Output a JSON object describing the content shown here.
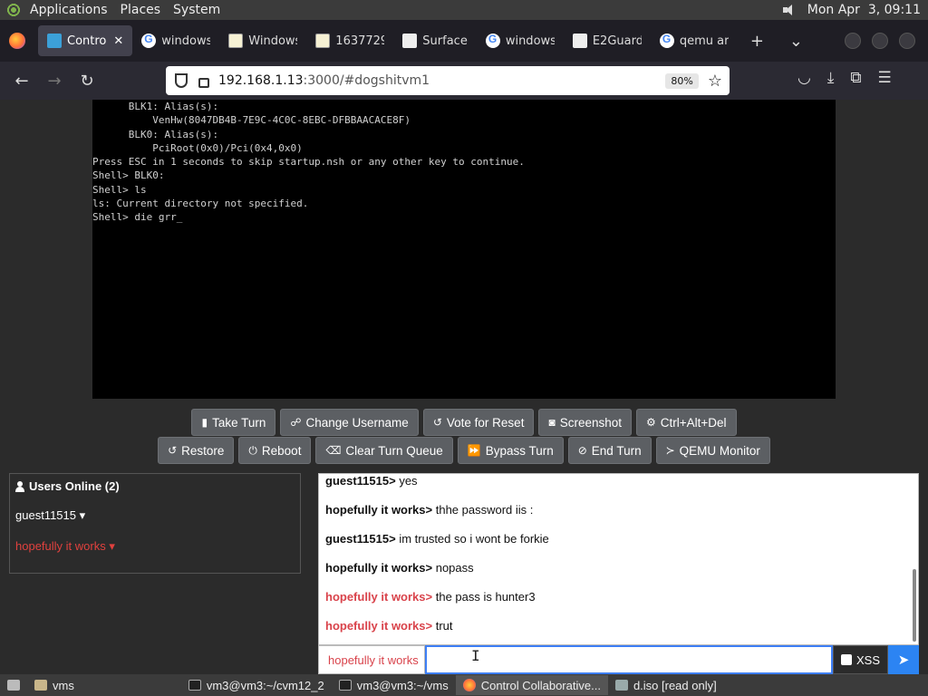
{
  "top_panel": {
    "menus": [
      "Applications",
      "Places",
      "System"
    ],
    "clock": "Mon Apr  3, 09:11"
  },
  "tabs": [
    {
      "label": "Contro",
      "icon": "monitor-icon",
      "active": true
    },
    {
      "label": "windows",
      "icon": "google-icon"
    },
    {
      "label": "Windows",
      "icon": "ba-icon"
    },
    {
      "label": "1637729",
      "icon": "ba-icon"
    },
    {
      "label": "Surface",
      "icon": "bank-icon"
    },
    {
      "label": "windows",
      "icon": "google-icon"
    },
    {
      "label": "E2Guard",
      "icon": "bank-icon"
    },
    {
      "label": "qemu ar",
      "icon": "google-icon"
    }
  ],
  "address_bar": {
    "host": "192.168.1.13",
    "path": ":3000/#dogshitvm1",
    "zoom": "80%"
  },
  "vm_console": {
    "lines": [
      "      BLK1: Alias(s):",
      "          VenHw(8047DB4B-7E9C-4C0C-8EBC-DFBBAACACE8F)",
      "      BLK0: Alias(s):",
      "          PciRoot(0x0)/Pci(0x4,0x0)",
      "Press ESC in 1 seconds to skip startup.nsh or any other key to continue.",
      "Shell> BLK0:",
      "Shell> ls",
      "ls: Current directory not specified.",
      "Shell> die grr_"
    ]
  },
  "controls": {
    "row1": [
      {
        "label": "Take Turn",
        "icon": "mouse-icon"
      },
      {
        "label": "Change Username",
        "icon": "users-icon"
      },
      {
        "label": "Vote for Reset",
        "icon": "undo-icon"
      },
      {
        "label": "Screenshot",
        "icon": "camera-icon"
      },
      {
        "label": "Ctrl+Alt+Del",
        "icon": "gear-icon"
      }
    ],
    "row2": [
      {
        "label": "Restore",
        "icon": "restore-icon"
      },
      {
        "label": "Reboot",
        "icon": "power-icon"
      },
      {
        "label": "Clear Turn Queue",
        "icon": "eraser-icon"
      },
      {
        "label": "Bypass Turn",
        "icon": "fast-forward-icon"
      },
      {
        "label": "End Turn",
        "icon": "ban-icon"
      },
      {
        "label": "QEMU Monitor",
        "icon": "terminal-icon"
      }
    ]
  },
  "users_panel": {
    "title": "Users Online (2)",
    "users": [
      {
        "name": "guest11515",
        "color": "#ffffff"
      },
      {
        "name": "hopefully it works",
        "color": "#e0413e"
      }
    ]
  },
  "chat": {
    "messages": [
      {
        "user": "guest11515",
        "text": "yes",
        "red": false
      },
      {
        "user": "hopefully it works",
        "text": "thhe password iis :",
        "red": false
      },
      {
        "user": "guest11515",
        "text": "im trusted so i wont be forkie",
        "red": false
      },
      {
        "user": "hopefully it works",
        "text": "nopass",
        "red": false
      },
      {
        "user": "hopefully it works",
        "text": "the pass is hunter3",
        "red": true
      },
      {
        "user": "hopefully it works",
        "text": "trut",
        "red": true
      }
    ],
    "input_username": "hopefully it works",
    "xss_label": "XSS"
  },
  "taskbar": {
    "items": [
      {
        "label": "vms",
        "icon": "folder-icon"
      },
      {
        "label": "vm3@vm3:~/cvm12_2",
        "icon": "terminal-icon"
      },
      {
        "label": "vm3@vm3:~/vms",
        "icon": "terminal-icon"
      },
      {
        "label": "Control Collaborative...",
        "icon": "firefox-icon",
        "active": true
      },
      {
        "label": "d.iso [read only]",
        "icon": "disk-icon"
      }
    ]
  }
}
